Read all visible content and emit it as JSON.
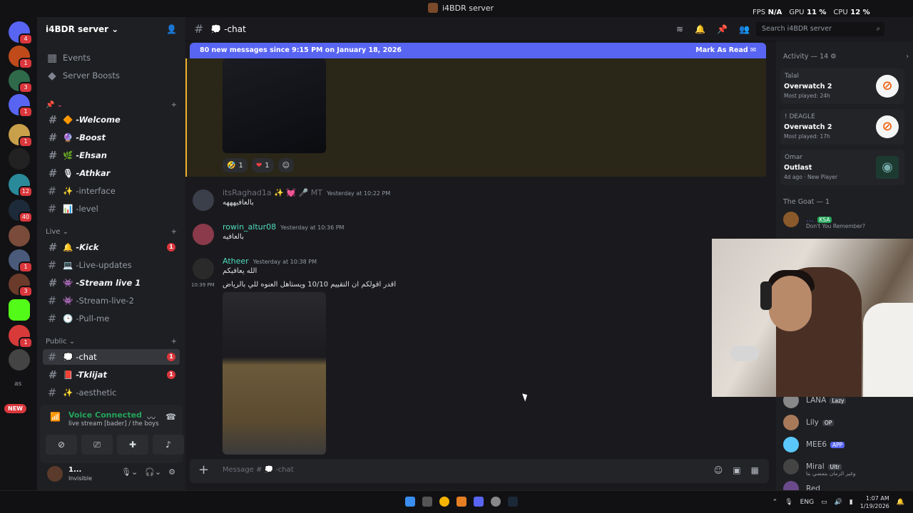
{
  "window": {
    "title": "i4BDR server"
  },
  "overlay": {
    "fps_label": "FPS",
    "fps_value": "N/A",
    "gpu_label": "GPU",
    "gpu_value": "11 %",
    "cpu_label": "CPU",
    "cpu_value": "12 %"
  },
  "servers": {
    "badges": [
      "4",
      "1",
      "3",
      "1",
      "1",
      "12",
      "40",
      "1",
      "3",
      "1"
    ],
    "new_tag": "NEW",
    "as_label": "as"
  },
  "guild": {
    "name": "i4BDR server",
    "events": "Events",
    "boosts": "Server Boosts",
    "categories": {
      "live": "Live",
      "public": "Public"
    },
    "channels_top": [
      {
        "emoji": "🔶",
        "name": "-Welcome"
      },
      {
        "emoji": "🔮",
        "name": "-Boost"
      },
      {
        "emoji": "🌿",
        "name": "-Ehsan"
      },
      {
        "emoji": "🎙",
        "name": "-Athkar"
      },
      {
        "emoji": "✨",
        "name": "-interface"
      },
      {
        "emoji": "📊",
        "name": "-level"
      }
    ],
    "channels_live": [
      {
        "emoji": "🔔",
        "name": "-Kick",
        "count": "1"
      },
      {
        "emoji": "💻",
        "name": "-Live-updates"
      },
      {
        "emoji": "👾",
        "name": "-Stream live 1"
      },
      {
        "emoji": "👾",
        "name": "-Stream-live-2"
      },
      {
        "emoji": "🕒",
        "name": "-Pull-me"
      }
    ],
    "channels_public": [
      {
        "emoji": "💭",
        "name": "-chat",
        "count": "1"
      },
      {
        "emoji": "📕",
        "name": "-Tklijat",
        "count": "1"
      },
      {
        "emoji": "✨",
        "name": "-aesthetic"
      }
    ]
  },
  "voice": {
    "status": "Voice Connected",
    "sub": "live stream [bader] / the boys"
  },
  "user": {
    "name": "1...",
    "status": "Invisible"
  },
  "chat": {
    "channel_name": "-chat",
    "channel_emoji": "💭",
    "search_placeholder": "Search i4BDR server",
    "new_messages": "80 new messages since 9:15 PM on January 18, 2026",
    "mark_as_read": "Mark As Read",
    "reactions": [
      {
        "emoji": "🤣",
        "count": "1"
      },
      {
        "emoji": "❤",
        "count": "1"
      }
    ],
    "messages": [
      {
        "author": "itsRaghad1a ✨ 💓 🎤 MT",
        "time": "Yesterday at 10:22 PM",
        "text": "بالعافيهههه"
      },
      {
        "author": "rowin_altur08",
        "time": "Yesterday at 10:36 PM",
        "text": "بالعافيه"
      },
      {
        "author": "Atheer",
        "time": "Yesterday at 10:38 PM",
        "text": "الله يعافيكم",
        "text2": "اقدر اقولكم ان التقييم 10/10 ويستاهل العنوه للي بالرياض",
        "side_time": "10:39 PM"
      }
    ],
    "composer_placeholder": "Message # 💭 -chat"
  },
  "members": {
    "activity_header": "Activity — 14",
    "activities": [
      {
        "user": "Talal",
        "game": "Overwatch 2",
        "sub": "Most played: 24h"
      },
      {
        "user": "! DEAGLE",
        "game": "Overwatch 2",
        "sub": "Most played: 17h"
      },
      {
        "user": "Omar",
        "game": "Outlast",
        "sub": "4d ago · New Player"
      }
    ],
    "goat_header": "The Goat — 1",
    "goat_member": {
      "name": "KSA",
      "sub": "Don't You Remember?"
    },
    "list": [
      {
        "name": "LANA",
        "tag": "Lazy"
      },
      {
        "name": "Lily",
        "tag": "OP"
      },
      {
        "name": "MEE6",
        "tag": "APP"
      },
      {
        "name": "Miral",
        "tag": "Ultr",
        "sub": "وغير الزمان بتمضي بنا"
      },
      {
        "name": "Red"
      }
    ]
  },
  "taskbar": {
    "lang": "ENG",
    "time": "1:07 AM",
    "date": "1/19/2026"
  }
}
